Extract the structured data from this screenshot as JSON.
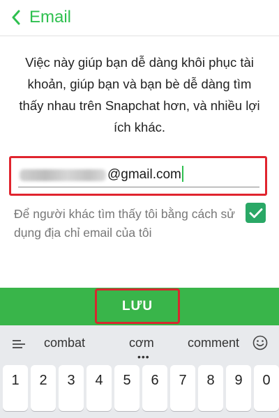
{
  "header": {
    "title": "Email",
    "back_icon": "chevron-left-icon",
    "accent": "#2ec04f"
  },
  "description": "Việc này giúp bạn dễ dàng khôi phục tài khoản, giúp bạn và bạn bè dễ dàng tìm thấy nhau trên Snapchat hơn, và nhiều lợi ích khác.",
  "email": {
    "visible_value": "@gmail.com",
    "highlight": "#e0242e"
  },
  "find_me": {
    "label": "Để người khác tìm thấy tôi bằng cách sử dụng địa chỉ email của tôi",
    "checked": true,
    "check_color": "#2aa866"
  },
  "save": {
    "label": "LƯU",
    "bar_color": "#39b54a"
  },
  "keyboard": {
    "suggestions": [
      "combat",
      "cơm",
      "comment"
    ],
    "more_dots": "•••",
    "menu_icon": "menu-lines-icon",
    "emoji_icon": "emoji-smile-icon",
    "number_keys": [
      "1",
      "2",
      "3",
      "4",
      "5",
      "6",
      "7",
      "8",
      "9",
      "0"
    ]
  }
}
